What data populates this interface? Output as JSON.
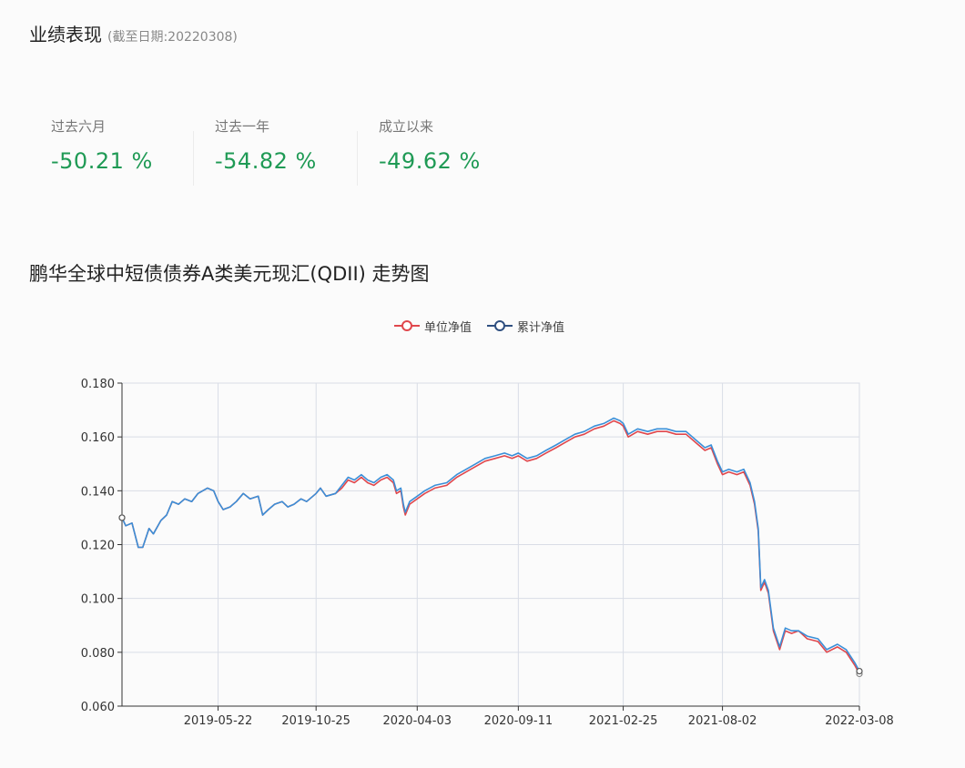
{
  "header": {
    "title": "业绩表现",
    "date_note": "(截至日期:20220308)"
  },
  "stats": [
    {
      "label": "过去六月",
      "value": "-50.21 %"
    },
    {
      "label": "过去一年",
      "value": "-54.82 %"
    },
    {
      "label": "成立以来",
      "value": "-49.62 %"
    }
  ],
  "colors": {
    "positive_green": "#1f9a55",
    "unit_nav": "#e0474c",
    "cum_nav": "#3a8fd8",
    "cum_nav_legend": "#2f4f80"
  },
  "chart_data": {
    "type": "line",
    "title": "鹏华全球中短债债券A类美元现汇(QDII) 走势图",
    "legend_position": "top-center",
    "grid": true,
    "legend": [
      "单位净值",
      "累计净值"
    ],
    "x_tick_labels": [
      "2019-05-22",
      "2019-10-25",
      "2020-04-03",
      "2020-09-11",
      "2021-02-25",
      "2021-08-02",
      "2022-03-08"
    ],
    "y_tick_labels": [
      "0.180",
      "0.160",
      "0.140",
      "0.120",
      "0.100",
      "0.080",
      "0.060"
    ],
    "ylim": [
      0.06,
      0.18
    ],
    "xlim": [
      "2018-12-20",
      "2022-03-08"
    ],
    "series": [
      {
        "name": "单位净值",
        "points": [
          [
            "2018-12-20",
            0.13
          ],
          [
            "2018-12-26",
            0.127
          ],
          [
            "2019-01-05",
            0.128
          ],
          [
            "2019-01-15",
            0.119
          ],
          [
            "2019-01-22",
            0.119
          ],
          [
            "2019-02-01",
            0.126
          ],
          [
            "2019-02-08",
            0.124
          ],
          [
            "2019-02-20",
            0.129
          ],
          [
            "2019-03-01",
            0.131
          ],
          [
            "2019-03-10",
            0.136
          ],
          [
            "2019-03-20",
            0.135
          ],
          [
            "2019-03-30",
            0.137
          ],
          [
            "2019-04-10",
            0.136
          ],
          [
            "2019-04-20",
            0.139
          ],
          [
            "2019-05-05",
            0.141
          ],
          [
            "2019-05-15",
            0.14
          ],
          [
            "2019-05-22",
            0.136
          ],
          [
            "2019-05-30",
            0.133
          ],
          [
            "2019-06-10",
            0.134
          ],
          [
            "2019-06-20",
            0.136
          ],
          [
            "2019-07-01",
            0.139
          ],
          [
            "2019-07-12",
            0.137
          ],
          [
            "2019-07-25",
            0.138
          ],
          [
            "2019-08-01",
            0.131
          ],
          [
            "2019-08-10",
            0.133
          ],
          [
            "2019-08-20",
            0.135
          ],
          [
            "2019-09-01",
            0.136
          ],
          [
            "2019-09-10",
            0.134
          ],
          [
            "2019-09-20",
            0.135
          ],
          [
            "2019-10-01",
            0.137
          ],
          [
            "2019-10-10",
            0.136
          ],
          [
            "2019-10-25",
            0.139
          ],
          [
            "2019-11-01",
            0.141
          ],
          [
            "2019-11-10",
            0.138
          ],
          [
            "2019-11-25",
            0.139
          ],
          [
            "2019-12-05",
            0.141
          ],
          [
            "2019-12-15",
            0.144
          ],
          [
            "2019-12-25",
            0.143
          ],
          [
            "2020-01-05",
            0.145
          ],
          [
            "2020-01-15",
            0.143
          ],
          [
            "2020-01-25",
            0.142
          ],
          [
            "2020-02-05",
            0.144
          ],
          [
            "2020-02-15",
            0.145
          ],
          [
            "2020-02-25",
            0.143
          ],
          [
            "2020-03-01",
            0.139
          ],
          [
            "2020-03-08",
            0.14
          ],
          [
            "2020-03-12",
            0.134
          ],
          [
            "2020-03-15",
            0.131
          ],
          [
            "2020-03-22",
            0.135
          ],
          [
            "2020-04-03",
            0.137
          ],
          [
            "2020-04-15",
            0.139
          ],
          [
            "2020-05-01",
            0.141
          ],
          [
            "2020-05-20",
            0.142
          ],
          [
            "2020-06-05",
            0.145
          ],
          [
            "2020-06-20",
            0.147
          ],
          [
            "2020-07-05",
            0.149
          ],
          [
            "2020-07-20",
            0.151
          ],
          [
            "2020-08-05",
            0.152
          ],
          [
            "2020-08-20",
            0.153
          ],
          [
            "2020-09-01",
            0.152
          ],
          [
            "2020-09-11",
            0.153
          ],
          [
            "2020-09-25",
            0.151
          ],
          [
            "2020-10-10",
            0.152
          ],
          [
            "2020-10-25",
            0.154
          ],
          [
            "2020-11-10",
            0.156
          ],
          [
            "2020-11-25",
            0.158
          ],
          [
            "2020-12-10",
            0.16
          ],
          [
            "2020-12-25",
            0.161
          ],
          [
            "2021-01-10",
            0.163
          ],
          [
            "2021-01-25",
            0.164
          ],
          [
            "2021-02-10",
            0.166
          ],
          [
            "2021-02-20",
            0.165
          ],
          [
            "2021-02-25",
            0.164
          ],
          [
            "2021-03-05",
            0.16
          ],
          [
            "2021-03-20",
            0.162
          ],
          [
            "2021-04-05",
            0.161
          ],
          [
            "2021-04-20",
            0.162
          ],
          [
            "2021-05-05",
            0.162
          ],
          [
            "2021-05-20",
            0.161
          ],
          [
            "2021-06-05",
            0.161
          ],
          [
            "2021-06-20",
            0.158
          ],
          [
            "2021-07-05",
            0.155
          ],
          [
            "2021-07-15",
            0.156
          ],
          [
            "2021-07-25",
            0.15
          ],
          [
            "2021-08-02",
            0.146
          ],
          [
            "2021-08-12",
            0.147
          ],
          [
            "2021-08-25",
            0.146
          ],
          [
            "2021-09-05",
            0.147
          ],
          [
            "2021-09-15",
            0.142
          ],
          [
            "2021-09-22",
            0.135
          ],
          [
            "2021-09-28",
            0.125
          ],
          [
            "2021-10-02",
            0.103
          ],
          [
            "2021-10-08",
            0.106
          ],
          [
            "2021-10-14",
            0.102
          ],
          [
            "2021-10-22",
            0.088
          ],
          [
            "2021-11-01",
            0.081
          ],
          [
            "2021-11-10",
            0.088
          ],
          [
            "2021-11-20",
            0.087
          ],
          [
            "2021-12-01",
            0.088
          ],
          [
            "2021-12-15",
            0.085
          ],
          [
            "2022-01-01",
            0.084
          ],
          [
            "2022-01-15",
            0.08
          ],
          [
            "2022-02-01",
            0.082
          ],
          [
            "2022-02-15",
            0.08
          ],
          [
            "2022-03-01",
            0.075
          ],
          [
            "2022-03-08",
            0.072
          ]
        ]
      },
      {
        "name": "累计净值",
        "points": [
          [
            "2018-12-20",
            0.13
          ],
          [
            "2018-12-26",
            0.127
          ],
          [
            "2019-01-05",
            0.128
          ],
          [
            "2019-01-15",
            0.119
          ],
          [
            "2019-01-22",
            0.119
          ],
          [
            "2019-02-01",
            0.126
          ],
          [
            "2019-02-08",
            0.124
          ],
          [
            "2019-02-20",
            0.129
          ],
          [
            "2019-03-01",
            0.131
          ],
          [
            "2019-03-10",
            0.136
          ],
          [
            "2019-03-20",
            0.135
          ],
          [
            "2019-03-30",
            0.137
          ],
          [
            "2019-04-10",
            0.136
          ],
          [
            "2019-04-20",
            0.139
          ],
          [
            "2019-05-05",
            0.141
          ],
          [
            "2019-05-15",
            0.14
          ],
          [
            "2019-05-22",
            0.136
          ],
          [
            "2019-05-30",
            0.133
          ],
          [
            "2019-06-10",
            0.134
          ],
          [
            "2019-06-20",
            0.136
          ],
          [
            "2019-07-01",
            0.139
          ],
          [
            "2019-07-12",
            0.137
          ],
          [
            "2019-07-25",
            0.138
          ],
          [
            "2019-08-01",
            0.131
          ],
          [
            "2019-08-10",
            0.133
          ],
          [
            "2019-08-20",
            0.135
          ],
          [
            "2019-09-01",
            0.136
          ],
          [
            "2019-09-10",
            0.134
          ],
          [
            "2019-09-20",
            0.135
          ],
          [
            "2019-10-01",
            0.137
          ],
          [
            "2019-10-10",
            0.136
          ],
          [
            "2019-10-25",
            0.139
          ],
          [
            "2019-11-01",
            0.141
          ],
          [
            "2019-11-10",
            0.138
          ],
          [
            "2019-11-25",
            0.139
          ],
          [
            "2019-12-05",
            0.142
          ],
          [
            "2019-12-15",
            0.145
          ],
          [
            "2019-12-25",
            0.144
          ],
          [
            "2020-01-05",
            0.146
          ],
          [
            "2020-01-15",
            0.144
          ],
          [
            "2020-01-25",
            0.143
          ],
          [
            "2020-02-05",
            0.145
          ],
          [
            "2020-02-15",
            0.146
          ],
          [
            "2020-02-25",
            0.144
          ],
          [
            "2020-03-01",
            0.14
          ],
          [
            "2020-03-08",
            0.141
          ],
          [
            "2020-03-12",
            0.135
          ],
          [
            "2020-03-15",
            0.132
          ],
          [
            "2020-03-22",
            0.136
          ],
          [
            "2020-04-03",
            0.138
          ],
          [
            "2020-04-15",
            0.14
          ],
          [
            "2020-05-01",
            0.142
          ],
          [
            "2020-05-20",
            0.143
          ],
          [
            "2020-06-05",
            0.146
          ],
          [
            "2020-06-20",
            0.148
          ],
          [
            "2020-07-05",
            0.15
          ],
          [
            "2020-07-20",
            0.152
          ],
          [
            "2020-08-05",
            0.153
          ],
          [
            "2020-08-20",
            0.154
          ],
          [
            "2020-09-01",
            0.153
          ],
          [
            "2020-09-11",
            0.154
          ],
          [
            "2020-09-25",
            0.152
          ],
          [
            "2020-10-10",
            0.153
          ],
          [
            "2020-10-25",
            0.155
          ],
          [
            "2020-11-10",
            0.157
          ],
          [
            "2020-11-25",
            0.159
          ],
          [
            "2020-12-10",
            0.161
          ],
          [
            "2020-12-25",
            0.162
          ],
          [
            "2021-01-10",
            0.164
          ],
          [
            "2021-01-25",
            0.165
          ],
          [
            "2021-02-10",
            0.167
          ],
          [
            "2021-02-20",
            0.166
          ],
          [
            "2021-02-25",
            0.165
          ],
          [
            "2021-03-05",
            0.161
          ],
          [
            "2021-03-20",
            0.163
          ],
          [
            "2021-04-05",
            0.162
          ],
          [
            "2021-04-20",
            0.163
          ],
          [
            "2021-05-05",
            0.163
          ],
          [
            "2021-05-20",
            0.162
          ],
          [
            "2021-06-05",
            0.162
          ],
          [
            "2021-06-20",
            0.159
          ],
          [
            "2021-07-05",
            0.156
          ],
          [
            "2021-07-15",
            0.157
          ],
          [
            "2021-07-25",
            0.151
          ],
          [
            "2021-08-02",
            0.147
          ],
          [
            "2021-08-12",
            0.148
          ],
          [
            "2021-08-25",
            0.147
          ],
          [
            "2021-09-05",
            0.148
          ],
          [
            "2021-09-15",
            0.143
          ],
          [
            "2021-09-22",
            0.136
          ],
          [
            "2021-09-28",
            0.126
          ],
          [
            "2021-10-02",
            0.104
          ],
          [
            "2021-10-08",
            0.107
          ],
          [
            "2021-10-14",
            0.103
          ],
          [
            "2021-10-22",
            0.089
          ],
          [
            "2021-11-01",
            0.082
          ],
          [
            "2021-11-10",
            0.089
          ],
          [
            "2021-11-20",
            0.088
          ],
          [
            "2021-12-01",
            0.088
          ],
          [
            "2021-12-15",
            0.086
          ],
          [
            "2022-01-01",
            0.085
          ],
          [
            "2022-01-15",
            0.081
          ],
          [
            "2022-02-01",
            0.083
          ],
          [
            "2022-02-15",
            0.081
          ],
          [
            "2022-03-01",
            0.076
          ],
          [
            "2022-03-08",
            0.073
          ]
        ]
      }
    ]
  }
}
